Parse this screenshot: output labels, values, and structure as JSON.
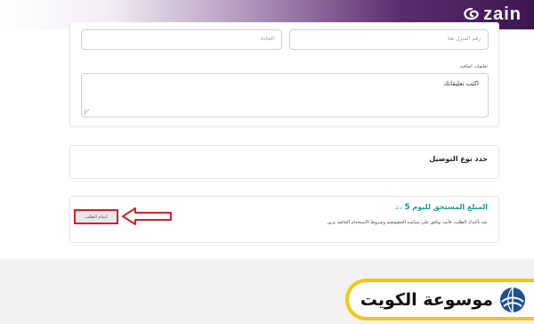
{
  "header": {
    "logo_text": "zain",
    "brand_colors": {
      "purple_dark": "#3d1650",
      "purple": "#5b2c6f"
    }
  },
  "form": {
    "house_placeholder": "رقم المنزل هنا",
    "avenue_placeholder": "الجادة",
    "comments_label": "تعليقات اضافية",
    "comments_placeholder": "اكتب تعليقاتك"
  },
  "delivery": {
    "title": "حدد نوع التوصيل"
  },
  "total": {
    "label": "المبلغ المستحق لليوم",
    "amount": "5",
    "currency": "د.ك",
    "note": "عند تأكيدك الطلب، فأنت توافق على سياسة الخصوصية وشروط الاستخدام الخاصة بزين",
    "accent_color": "#1a9b86"
  },
  "actions": {
    "complete_order": "اتمام الطلب",
    "highlight_color": "#d61f26"
  },
  "watermark": {
    "text": "موسوعة الكويت",
    "border_color": "#f5c518"
  }
}
